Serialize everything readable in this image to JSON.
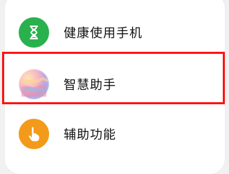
{
  "settings_list": {
    "items": [
      {
        "label": "健康使用手机",
        "icon": "hourglass-icon",
        "icon_color": "#29b14e"
      },
      {
        "label": "智慧助手",
        "icon": "smart-assistant-orb-icon",
        "icon_color": "#b9a4e8"
      },
      {
        "label": "辅助功能",
        "icon": "hand-pointer-icon",
        "icon_color": "#f39a1a"
      }
    ]
  },
  "highlight": {
    "color": "#ff1212",
    "target": "智慧助手"
  }
}
